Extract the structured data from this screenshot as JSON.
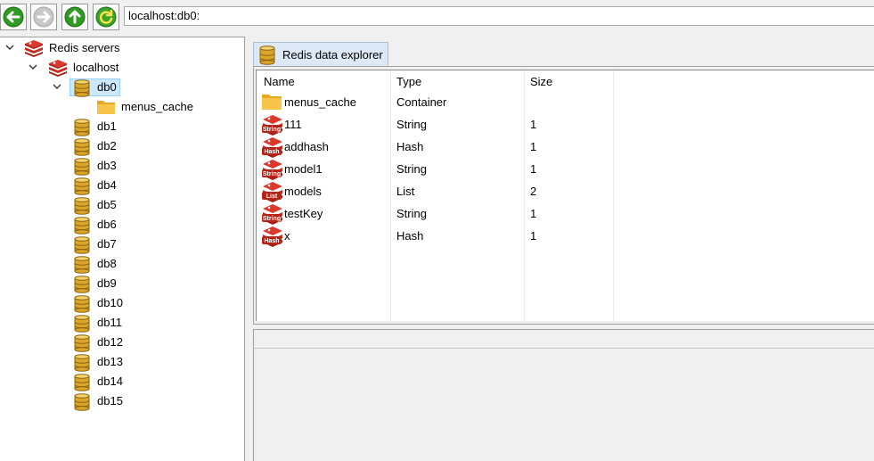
{
  "toolbar": {
    "back_icon": "back-arrow-icon",
    "forward_icon": "forward-arrow-icon",
    "up_icon": "up-arrow-icon",
    "refresh_icon": "refresh-icon",
    "address": "localhost:db0:"
  },
  "tree": {
    "root": {
      "label": "Redis servers",
      "icon": "redis-icon"
    },
    "server": {
      "label": "localhost",
      "icon": "redis-icon"
    },
    "selected_db": {
      "label": "db0",
      "icon": "database-icon"
    },
    "selected_child": {
      "label": "menus_cache",
      "icon": "folder-icon"
    },
    "databases": [
      "db1",
      "db2",
      "db3",
      "db4",
      "db5",
      "db6",
      "db7",
      "db8",
      "db9",
      "db10",
      "db11",
      "db12",
      "db13",
      "db14",
      "db15"
    ]
  },
  "tab": {
    "label": "Redis data explorer",
    "icon": "database-icon"
  },
  "grid": {
    "columns": [
      "Name",
      "Type",
      "Size"
    ],
    "rows": [
      {
        "name": "menus_cache",
        "type": "Container",
        "size": "",
        "icon": "folder-icon"
      },
      {
        "name": "111",
        "type": "String",
        "size": "1",
        "icon": "redis-string-icon",
        "badge": "String"
      },
      {
        "name": "addhash",
        "type": "Hash",
        "size": "1",
        "icon": "redis-hash-icon",
        "badge": "Hash"
      },
      {
        "name": "model1",
        "type": "String",
        "size": "1",
        "icon": "redis-string-icon",
        "badge": "String"
      },
      {
        "name": "models",
        "type": "List",
        "size": "2",
        "icon": "redis-list-icon",
        "badge": "List"
      },
      {
        "name": "testKey",
        "type": "String",
        "size": "1",
        "icon": "redis-string-icon",
        "badge": "String"
      },
      {
        "name": "x",
        "type": "Hash",
        "size": "1",
        "icon": "redis-hash-icon",
        "badge": "Hash"
      }
    ]
  },
  "colors": {
    "selection": "#cce8ff",
    "tab_bg": "#dde9f6",
    "redis_red": "#c62d20",
    "db_gold": "#d9a62a",
    "folder": "#f1b535",
    "nav_green": "#3aa52a"
  }
}
